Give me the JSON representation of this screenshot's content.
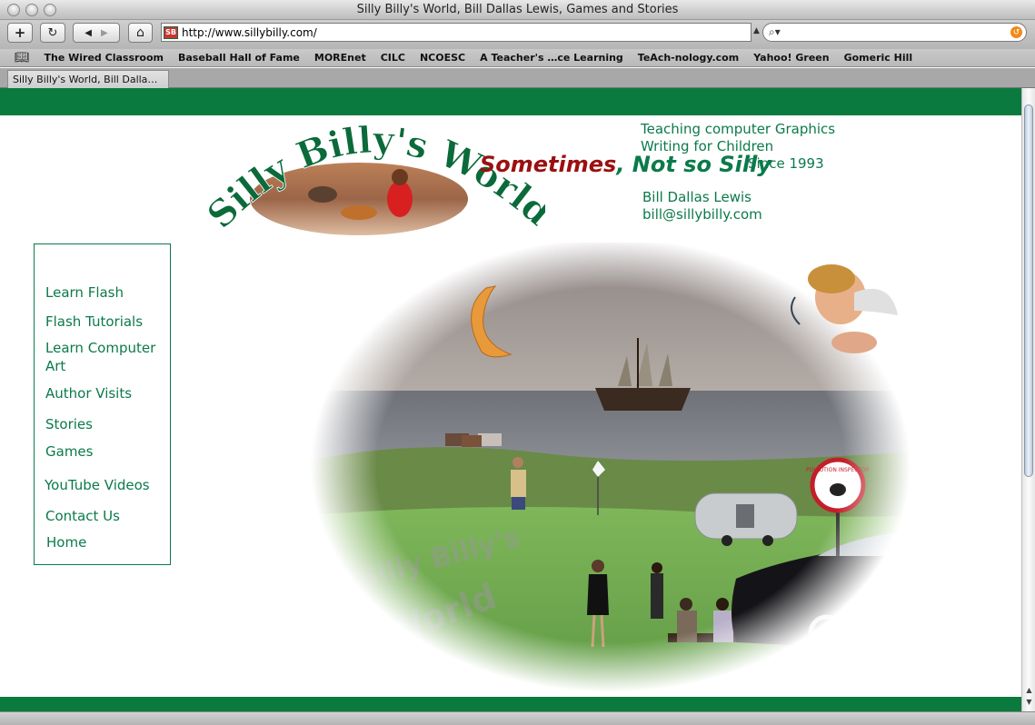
{
  "browser": {
    "window_title": "Silly Billy's World, Bill Dallas Lewis, Games and Stories",
    "url": "http://www.sillybilly.com/",
    "favicon_text": "SB",
    "bookmarks": [
      "The Wired Classroom",
      "Baseball Hall of Fame",
      "MOREnet",
      "CILC",
      "NCOESC",
      "A Teacher's …ce Learning",
      "TeAch-nology.com",
      "Yahoo! Green",
      "Gomeric Hill"
    ],
    "active_tab": "Silly Billy's World, Bill Dalla…"
  },
  "header": {
    "logo_text": "Silly Billy's World",
    "tagline_red": "Sometimes",
    "tagline_green": ", Not so Silly",
    "line1": "Teaching computer Graphics",
    "line2": "Writing for Children",
    "since": "Since 1993",
    "author": "Bill Dallas Lewis",
    "email": "bill@sillybilly.com"
  },
  "nav": {
    "items": [
      "Learn Flash",
      "Flash Tutorials",
      "Learn Computer Art",
      "Author Visits",
      "Stories",
      "Games",
      "YouTube Videos",
      "Contact Us",
      "Home"
    ]
  },
  "scene": {
    "watermark_line1": "Silly Billy's",
    "watermark_line2": "World",
    "sign_text": "POLLUTION INSPECTOR"
  },
  "colors": {
    "brand_green": "#0b7a3e",
    "text_green": "#0b7a4a",
    "accent_red": "#9b1010"
  }
}
